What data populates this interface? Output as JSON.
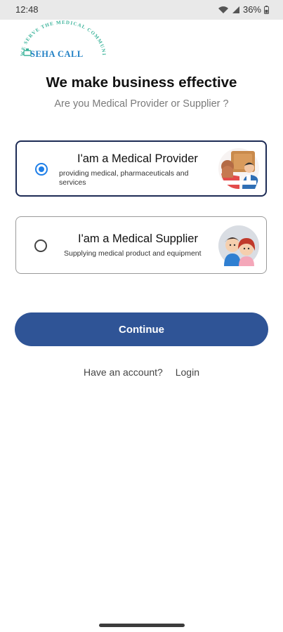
{
  "status_bar": {
    "time": "12:48",
    "battery": "36%"
  },
  "logo": {
    "brand_text": "SEHA CALL",
    "ring_text": "WE SERVE THE MEDICAL COMMUNITY"
  },
  "page": {
    "headline": "We make business effective",
    "subhead": "Are you Medical Provider or Supplier ?"
  },
  "options": [
    {
      "title": "I'am a Medical Provider",
      "description": "providing medical, pharmaceuticals and services",
      "selected": true
    },
    {
      "title": "I'am a Medical Supplier",
      "description": "Supplying medical product and equipment",
      "selected": false
    }
  ],
  "actions": {
    "continue_label": "Continue",
    "have_account_text": "Have an account?",
    "login_label": "Login"
  },
  "colors": {
    "primary": "#2f5496",
    "radio_selected": "#1f7fe8",
    "card_border_selected": "#1d2b55",
    "logo_blue": "#1f7fc4",
    "logo_green": "#3bb39a"
  },
  "icons": [
    "wifi-icon",
    "signal-icon",
    "battery-icon",
    "radio-selected-icon",
    "radio-unselected-icon",
    "provider-illustration",
    "supplier-illustration"
  ]
}
